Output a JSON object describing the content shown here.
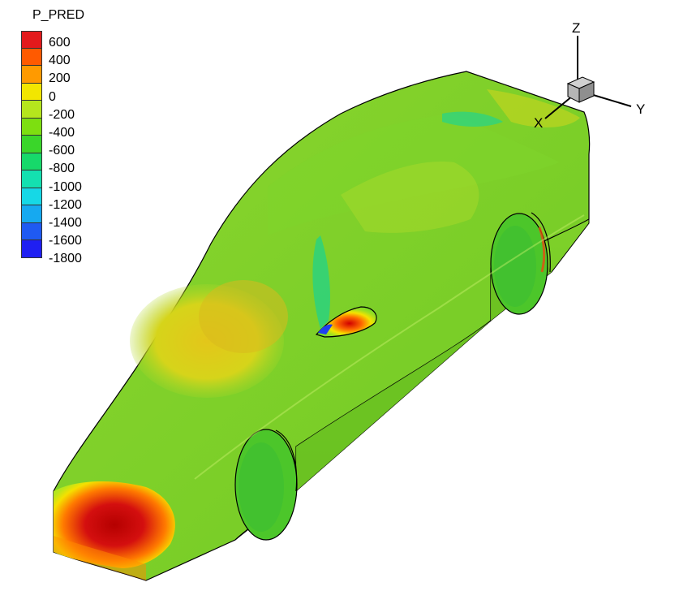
{
  "legend": {
    "title": "P_PRED",
    "entries": [
      {
        "label": "600",
        "color": "#e31a1c"
      },
      {
        "label": "400",
        "color": "#ff5a00"
      },
      {
        "label": "200",
        "color": "#ff9a00"
      },
      {
        "label": "0",
        "color": "#f2e600"
      },
      {
        "label": "-200",
        "color": "#b5e61d"
      },
      {
        "label": "-400",
        "color": "#7ddf10"
      },
      {
        "label": "-600",
        "color": "#3ad62a"
      },
      {
        "label": "-800",
        "color": "#17d96a"
      },
      {
        "label": "-1000",
        "color": "#14e0b0"
      },
      {
        "label": "-1200",
        "color": "#16d8e6"
      },
      {
        "label": "-1400",
        "color": "#16a9f0"
      },
      {
        "label": "-1600",
        "color": "#1f5af2"
      },
      {
        "label": "-1800",
        "color": "#1f1ff2"
      }
    ]
  },
  "axes": {
    "x_label": "X",
    "y_label": "Y",
    "z_label": "Z"
  }
}
